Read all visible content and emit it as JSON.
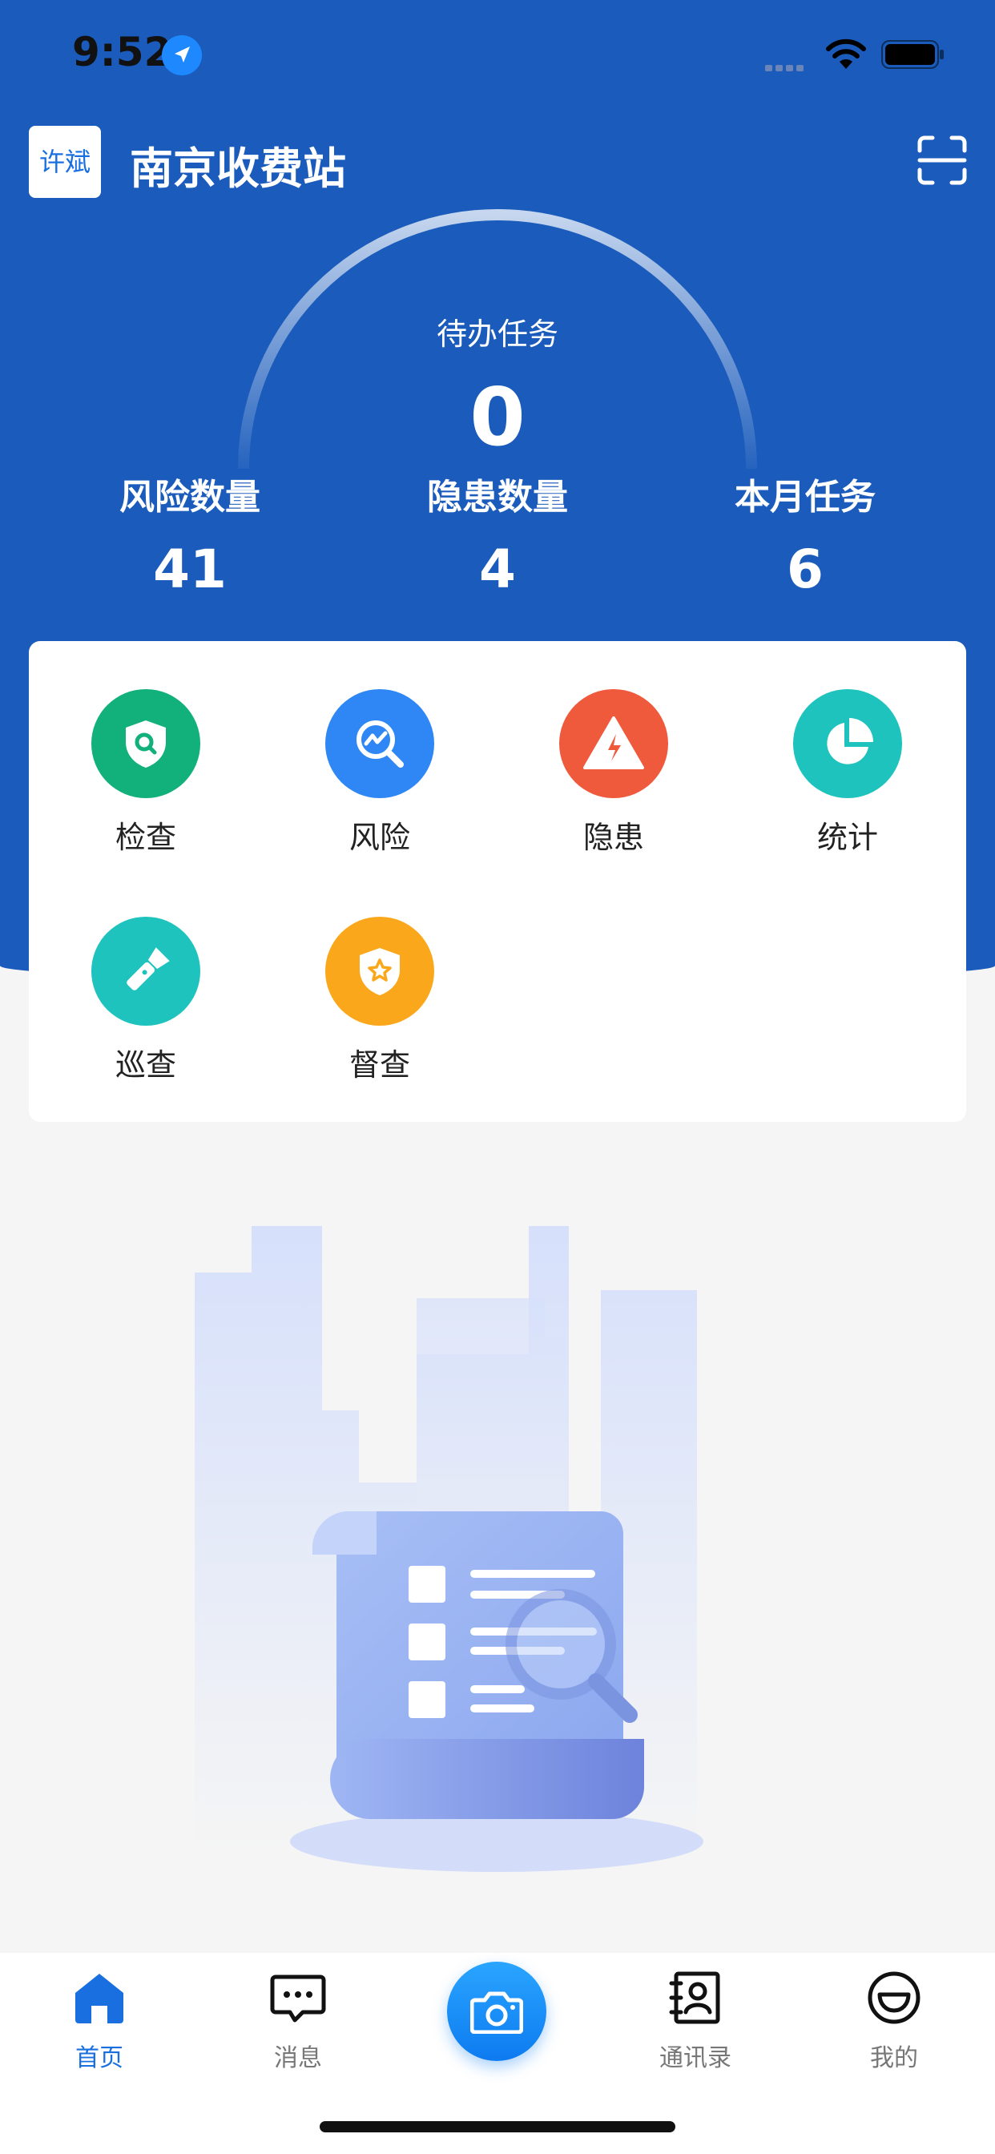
{
  "status_bar": {
    "time": "9:52"
  },
  "header": {
    "avatar_text": "许斌",
    "station_name": "南京收费站"
  },
  "dashboard": {
    "pending_label": "待办任务",
    "pending_value": "0",
    "stats": [
      {
        "label": "风险数量",
        "value": "41"
      },
      {
        "label": "隐患数量",
        "value": "4"
      },
      {
        "label": "本月任务",
        "value": "6"
      }
    ]
  },
  "menu": [
    {
      "label": "检查",
      "icon": "shield-search-icon",
      "color": "#12b07a"
    },
    {
      "label": "风险",
      "icon": "risk-search-icon",
      "color": "#2f86f5"
    },
    {
      "label": "隐患",
      "icon": "warning-triangle-icon",
      "color": "#f05a3c"
    },
    {
      "label": "统计",
      "icon": "pie-chart-icon",
      "color": "#1ec3bd"
    },
    {
      "label": "巡查",
      "icon": "flashlight-icon",
      "color": "#1ec3bd"
    },
    {
      "label": "督查",
      "icon": "shield-star-icon",
      "color": "#fba71c"
    }
  ],
  "tab_bar": {
    "tabs": [
      {
        "label": "首页",
        "icon": "home-icon",
        "active": true
      },
      {
        "label": "消息",
        "icon": "message-icon",
        "active": false
      },
      {
        "label": "通讯录",
        "icon": "contacts-icon",
        "active": false
      },
      {
        "label": "我的",
        "icon": "profile-icon",
        "active": false
      }
    ],
    "center_icon": "camera-icon"
  },
  "colors": {
    "brand_blue": "#1a5bbb",
    "active_tab": "#1a6fe0",
    "inactive_tab": "#777777"
  }
}
